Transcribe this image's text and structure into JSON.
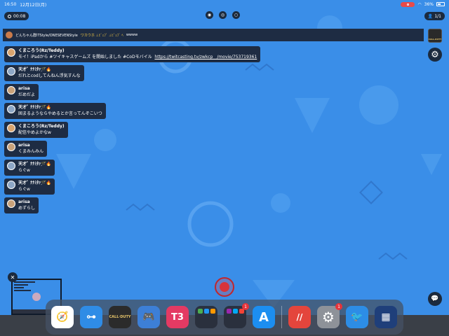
{
  "status_bar": {
    "time": "16:50",
    "date": "12月12日(月)",
    "battery": "36%"
  },
  "top": {
    "timer": "00:08",
    "viewers": "1/1"
  },
  "ticker": {
    "prefix": "どんちゃん群ITStyle/ONESEVENStyle",
    "highlight": "ワカウホ ⊥ﾋﾞｪﾌﾞ ⊥ﾋﾞｪﾌﾞ ﾍ ",
    "suffix": "wwww"
  },
  "game_thumb": {
    "label": "CALL·DUTY"
  },
  "chat": [
    {
      "name": "くまころう(Rz/Teddy)",
      "text": "モイ！iPadから #ツイキャスゲームズ を開始しました #CoDモバイル",
      "link": "https://twitcasting.tv/zwkcp__/movie/753719361"
    },
    {
      "name": "天才ﾟ ﾅﾅﾐﾀｧ🪄🔥",
      "text": "だれとcodしてんねん浮気すんな"
    },
    {
      "name": "arisa",
      "text": "だめだよ"
    },
    {
      "name": "天才ﾟ ﾅﾅﾐﾀｧ🪄🔥",
      "text": "固まるようならやめるとか言ってんぞこいつ"
    },
    {
      "name": "くまころう(Rz/Teddy)",
      "text": "配信やめよかなw"
    },
    {
      "name": "arisa",
      "text": "くまみんみん"
    },
    {
      "name": "天才ﾟ ﾅﾅﾐﾀｧ🪄🔥",
      "text": "らぐw"
    },
    {
      "name": "天才ﾟ ﾅﾅﾐﾀｧ🪄🔥",
      "text": "らぐw"
    },
    {
      "name": "arisa",
      "text": "めずらし"
    }
  ],
  "dock": {
    "apps": [
      {
        "name": "Safari",
        "color": "#ffffff",
        "glyph": "🧭",
        "badge": ""
      },
      {
        "name": "Key",
        "color": "#2f8ce6",
        "glyph": "⊶",
        "badge": ""
      },
      {
        "name": "Call of Duty",
        "color": "#2b2b2b",
        "glyph": "CALL·DUTY",
        "badge": ""
      },
      {
        "name": "Brawl",
        "color": "#3d7fd6",
        "glyph": "🎮",
        "badge": ""
      },
      {
        "name": "T3",
        "color": "#e43a63",
        "glyph": "T3",
        "badge": ""
      },
      {
        "name": "Folder 1",
        "color": "#2b3140",
        "glyph": "",
        "badge": ""
      },
      {
        "name": "Folder 2",
        "color": "#2b3140",
        "glyph": "",
        "badge": "1"
      },
      {
        "name": "App Store",
        "color": "#1c8ef0",
        "glyph": "A",
        "badge": ""
      }
    ],
    "recent": [
      {
        "name": "Recent 1",
        "color": "#e4453c",
        "glyph": "//",
        "badge": ""
      },
      {
        "name": "Settings",
        "color": "#8e9299",
        "glyph": "⚙",
        "badge": "1"
      },
      {
        "name": "Recent 3",
        "color": "#2d8de6",
        "glyph": "🐦",
        "badge": ""
      },
      {
        "name": "Recent 4",
        "color": "#1f3f7a",
        "glyph": "▦",
        "badge": ""
      }
    ]
  }
}
